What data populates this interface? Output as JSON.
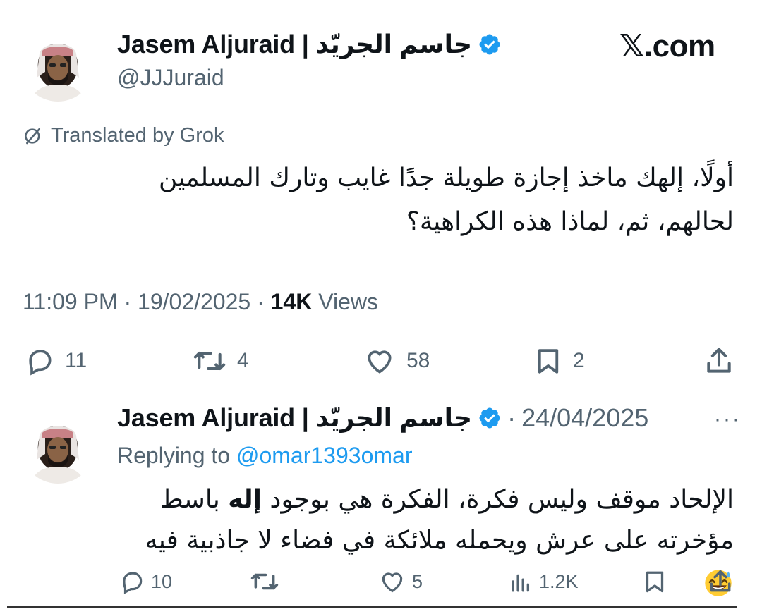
{
  "tweet": {
    "author_name": "Jasem Aljuraid | جاسم الجريّد",
    "author_handle": "@JJJuraid",
    "brand": "𝕏.com",
    "translated_label": "Translated by Grok",
    "text_line1": "أولًا، إلهك ماخذ إجازة طويلة جدًا غايب وتارك المسلمين",
    "text_line2": "لحالهم، ثم، لماذا هذه الكراهية؟",
    "time": "11:09 PM",
    "date": "19/02/2025",
    "views_count": "14K",
    "views_label": "Views",
    "replies": "11",
    "reposts": "4",
    "likes": "58",
    "bookmarks": "2"
  },
  "reply": {
    "author_name": "Jasem Aljuraid | جاسم الجريّد",
    "date": "24/04/2025",
    "replying_prefix": "Replying to",
    "replying_handle": "@omar1393omar",
    "text_line1_a": "الإلحاد موقف وليس فكرة، الفكرة هي بوجود ",
    "text_line1_bold": "إله",
    "text_line1_b": " باسط",
    "text_line2": "مؤخرته على عرش ويحمله ملائكة في فضاء لا جاذبية فيه",
    "replies": "10",
    "likes": "5",
    "views": "1.2K"
  },
  "colors": {
    "accent": "#1d9bf0",
    "text": "#0f1419",
    "muted": "#536471"
  },
  "icons": [
    "verified-badge-icon",
    "grok-icon",
    "reply-icon",
    "repost-icon",
    "like-icon",
    "bookmark-icon",
    "share-icon",
    "views-icon",
    "more-icon",
    "sweat-smile-emoji"
  ]
}
